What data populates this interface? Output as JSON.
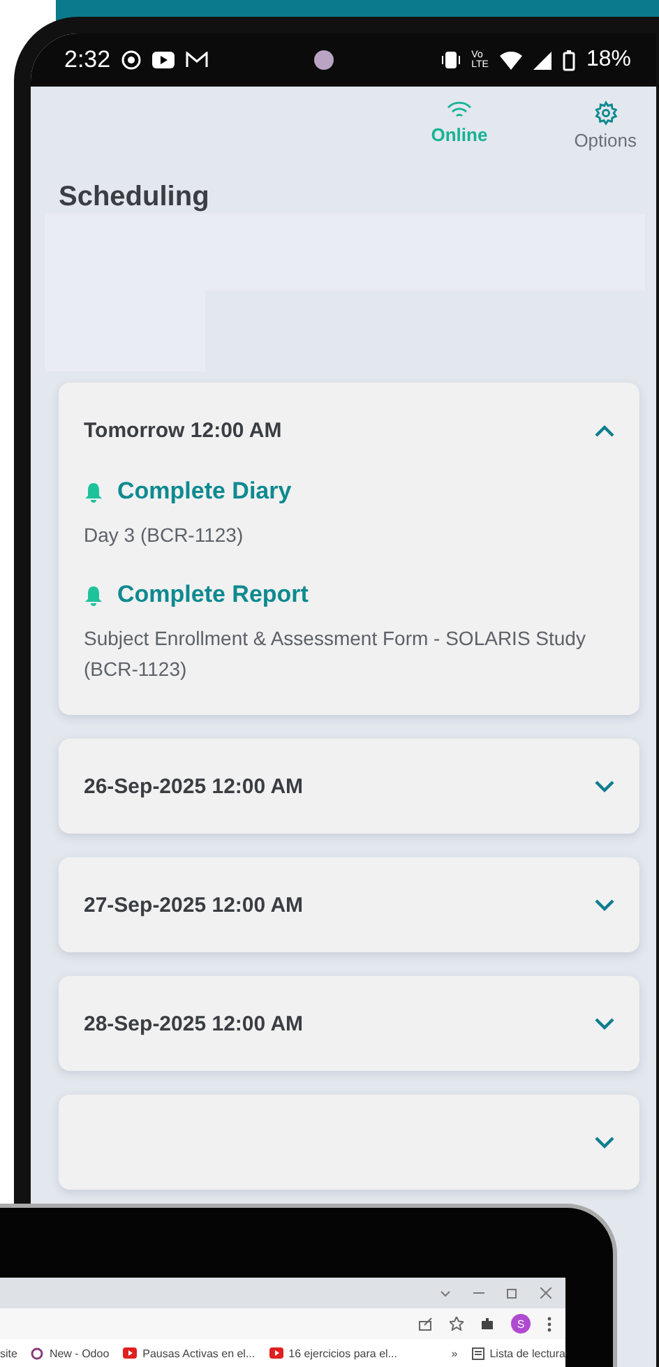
{
  "status_bar": {
    "time": "2:32",
    "volte": [
      "Vo",
      "LTE"
    ],
    "battery": "18%"
  },
  "header": {
    "actions": [
      {
        "kind": "wifi",
        "label": "Online",
        "selected": true
      },
      {
        "kind": "gear",
        "label": "Options",
        "selected": false
      }
    ]
  },
  "title": "Scheduling",
  "schedule": [
    {
      "date": "Tomorrow 12:00 AM",
      "expanded": true,
      "tasks": [
        {
          "title": "Complete Diary",
          "detail": "Day 3 (BCR-1123)"
        },
        {
          "title": "Complete Report",
          "detail": "Subject Enrollment & Assessment Form - SOLARIS Study (BCR-1123)"
        }
      ]
    },
    {
      "date": "26-Sep-2025 12:00 AM",
      "expanded": false
    },
    {
      "date": "27-Sep-2025 12:00 AM",
      "expanded": false
    },
    {
      "date": "28-Sep-2025 12:00 AM",
      "expanded": false
    },
    {
      "expanded": false
    }
  ],
  "browser": {
    "bookmarks": [
      {
        "kind": "site",
        "label": "site"
      },
      {
        "kind": "odoo",
        "label": "New - Odoo"
      },
      {
        "kind": "youtube",
        "label": "Pausas Activas en el..."
      },
      {
        "kind": "youtube",
        "label": "16 ejercicios para el..."
      }
    ],
    "more": "»",
    "reading_list": "Lista de lectura",
    "avatar": "S"
  }
}
